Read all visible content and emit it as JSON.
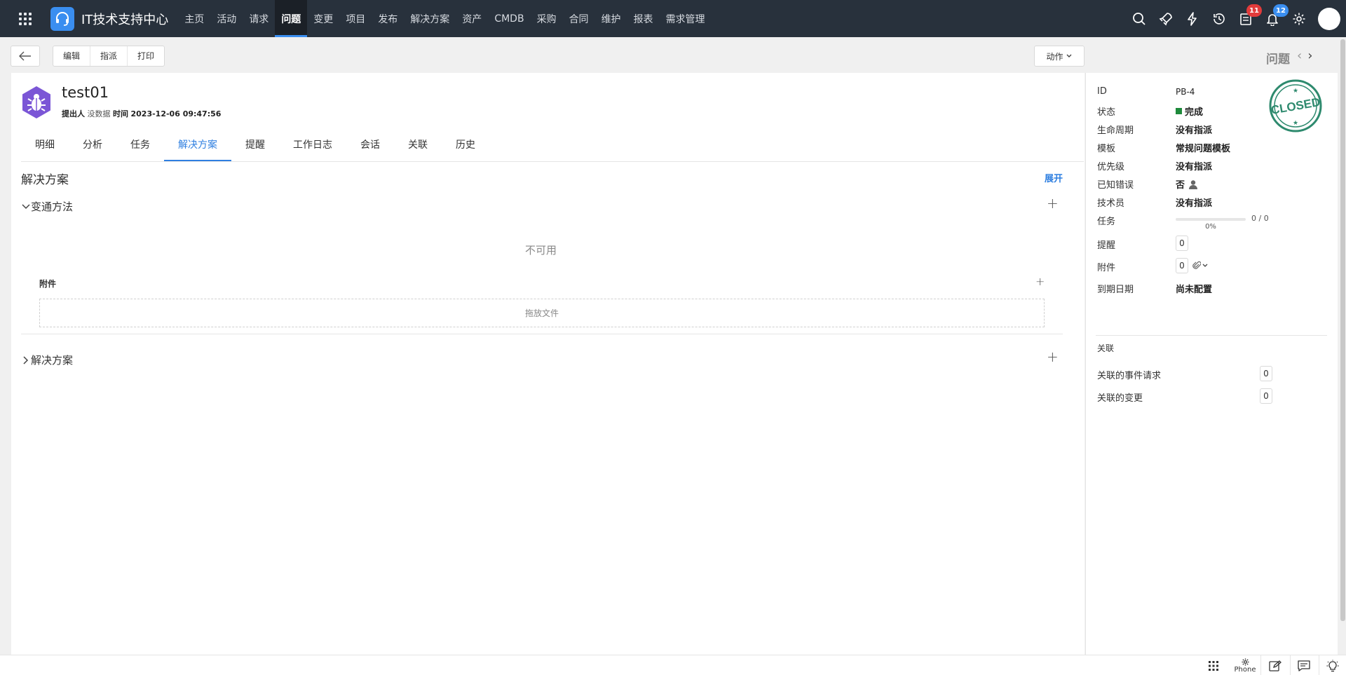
{
  "app": {
    "brand": "IT技术支持中心"
  },
  "nav": {
    "items": [
      "主页",
      "活动",
      "请求",
      "问题",
      "变更",
      "项目",
      "发布",
      "解决方案",
      "资产",
      "CMDB",
      "采购",
      "合同",
      "维护",
      "报表",
      "需求管理"
    ],
    "active_index": 3,
    "badges": {
      "tasks": "11",
      "notifications": "12"
    },
    "right_icons": [
      "search-icon",
      "rocket-icon",
      "lightning-icon",
      "history-icon",
      "task-list-icon",
      "bell-icon",
      "gear-icon",
      "avatar"
    ]
  },
  "toolbar": {
    "edit": "编辑",
    "assign": "指派",
    "print": "打印",
    "action": "动作",
    "entity": "问题"
  },
  "ticket": {
    "title": "test01",
    "requester_label": "提出人",
    "requester_value": "没数据",
    "time_label": "时间",
    "time_value": "2023-12-06 09:47:56"
  },
  "tabs": [
    "明细",
    "分析",
    "任务",
    "解决方案",
    "提醒",
    "工作日志",
    "会话",
    "关联",
    "历史"
  ],
  "tabs_active_index": 3,
  "content": {
    "section_title": "解决方案",
    "expand": "展开",
    "workaround": "变通方法",
    "not_available": "不可用",
    "attachments": "附件",
    "drop_files": "拖放文件",
    "solution": "解决方案"
  },
  "side": {
    "stamp_text": "CLOSED",
    "props": [
      {
        "k": "ID",
        "v": "PB-4"
      },
      {
        "k": "状态",
        "v": "完成"
      },
      {
        "k": "生命周期",
        "v": "没有指派"
      },
      {
        "k": "模板",
        "v": "常规问题模板"
      },
      {
        "k": "优先级",
        "v": "没有指派"
      },
      {
        "k": "已知错误",
        "v": "否"
      },
      {
        "k": "技术员",
        "v": "没有指派"
      },
      {
        "k": "任务",
        "v": "0 / 0",
        "progress_label": "0%"
      },
      {
        "k": "提醒",
        "v": "0"
      },
      {
        "k": "附件",
        "v": "0"
      },
      {
        "k": "到期日期",
        "v": "尚未配置"
      }
    ],
    "task_progress": 0,
    "status_color": "#1e8a3b",
    "related_title": "关联",
    "related": [
      {
        "k": "关联的事件请求",
        "v": "0"
      },
      {
        "k": "关联的变更",
        "v": "0"
      }
    ]
  },
  "bottom": {
    "phone": "Phone"
  }
}
